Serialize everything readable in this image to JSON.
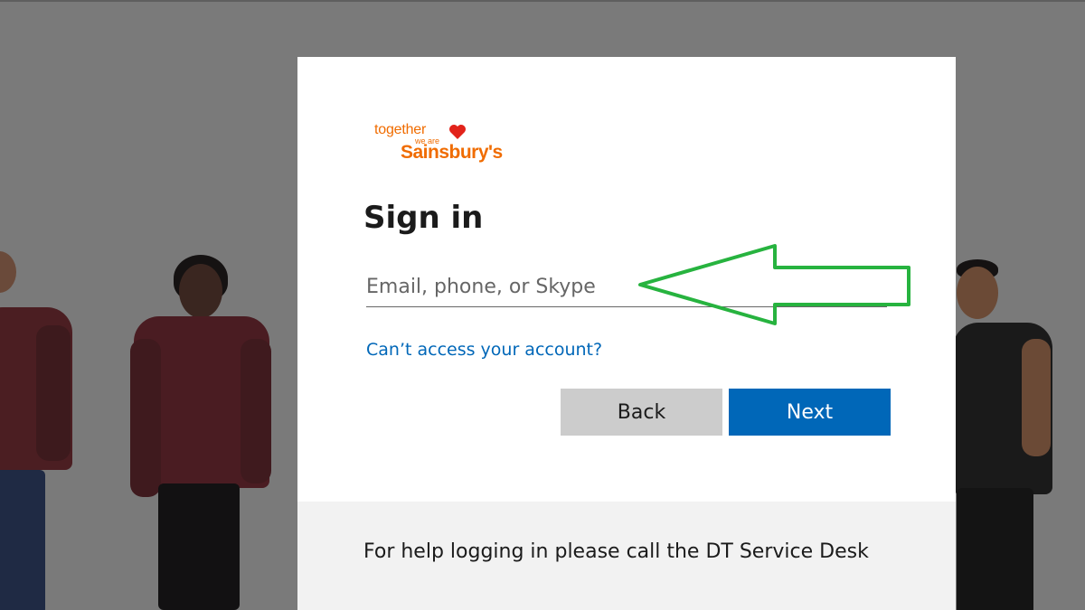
{
  "logo": {
    "line1": "together",
    "line2": "we are",
    "line3": "Sainsbury's"
  },
  "signin": {
    "title": "Sign in",
    "email_placeholder": "Email, phone, or Skype",
    "email_value": "",
    "cant_access": "Can’t access your account?",
    "back_label": "Back",
    "next_label": "Next"
  },
  "footer": {
    "help_text": "For help logging in please call the DT Service Desk"
  },
  "colors": {
    "brand_orange": "#f06c00",
    "primary_button": "#0067b8",
    "link": "#0067b8",
    "annotation_arrow": "#27b33f",
    "background": "#7a7a7a"
  },
  "icons": {
    "heart": "heart-icon",
    "annotation": "arrow-annotation"
  }
}
